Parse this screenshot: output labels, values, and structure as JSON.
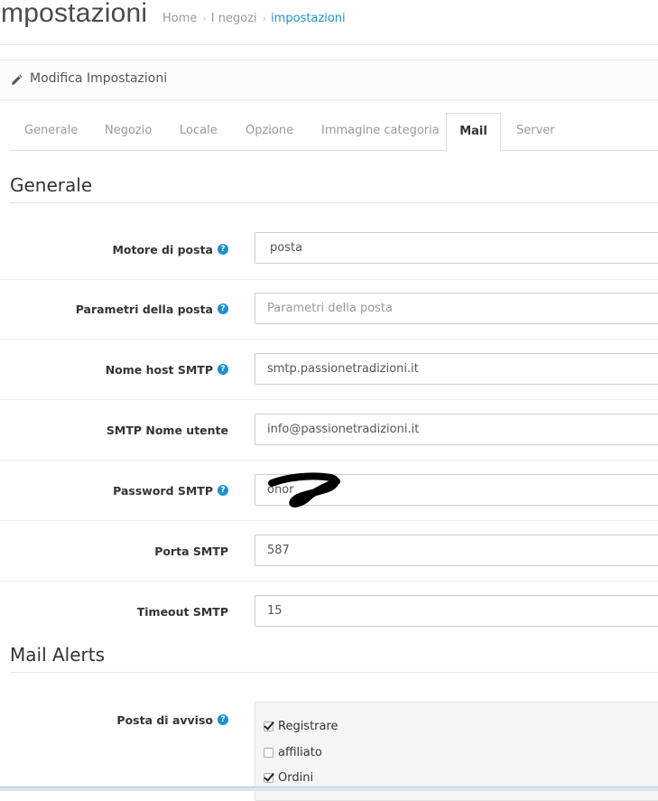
{
  "header": {
    "title": "mpostazioni",
    "breadcrumb": [
      "Home",
      "I negozi",
      "impostazioni"
    ]
  },
  "panel": {
    "title": "Modifica Impostazioni",
    "icon": "pencil-icon"
  },
  "tabs": [
    {
      "label": "Generale"
    },
    {
      "label": "Negozio"
    },
    {
      "label": "Locale"
    },
    {
      "label": "Opzione"
    },
    {
      "label": "Immagine categoria"
    },
    {
      "label": "Mail",
      "active": true
    },
    {
      "label": "Server"
    }
  ],
  "sections": {
    "general_legend": "Generale",
    "alerts_legend": "Mail Alerts"
  },
  "fields": {
    "mail_engine": {
      "label": "Motore di posta",
      "value": "posta",
      "help": true
    },
    "mail_params": {
      "label": "Parametri della posta",
      "value": "",
      "placeholder": "Parametri della posta",
      "help": true
    },
    "smtp_host": {
      "label": "Nome host SMTP",
      "value": "smtp.passionetradizioni.it",
      "help": true
    },
    "smtp_user": {
      "label": "SMTP Nome utente",
      "value": "info@passionetradizioni.it",
      "help": false
    },
    "smtp_password": {
      "label": "Password SMTP",
      "value": "onor",
      "help": true
    },
    "smtp_port": {
      "label": "Porta SMTP",
      "value": "587",
      "help": false
    },
    "smtp_timeout": {
      "label": "Timeout SMTP",
      "value": "15",
      "help": false
    }
  },
  "alerts": {
    "label": "Posta di avviso",
    "help": true,
    "options": [
      {
        "label": "Registrare",
        "checked": true
      },
      {
        "label": "affiliato",
        "checked": false
      },
      {
        "label": "Ordini",
        "checked": true
      }
    ]
  },
  "help_glyph": "?",
  "colors": {
    "accent": "#1e91cf",
    "breadcrumb_active": "#1e91cf",
    "well_bg": "#f5f5f5"
  }
}
